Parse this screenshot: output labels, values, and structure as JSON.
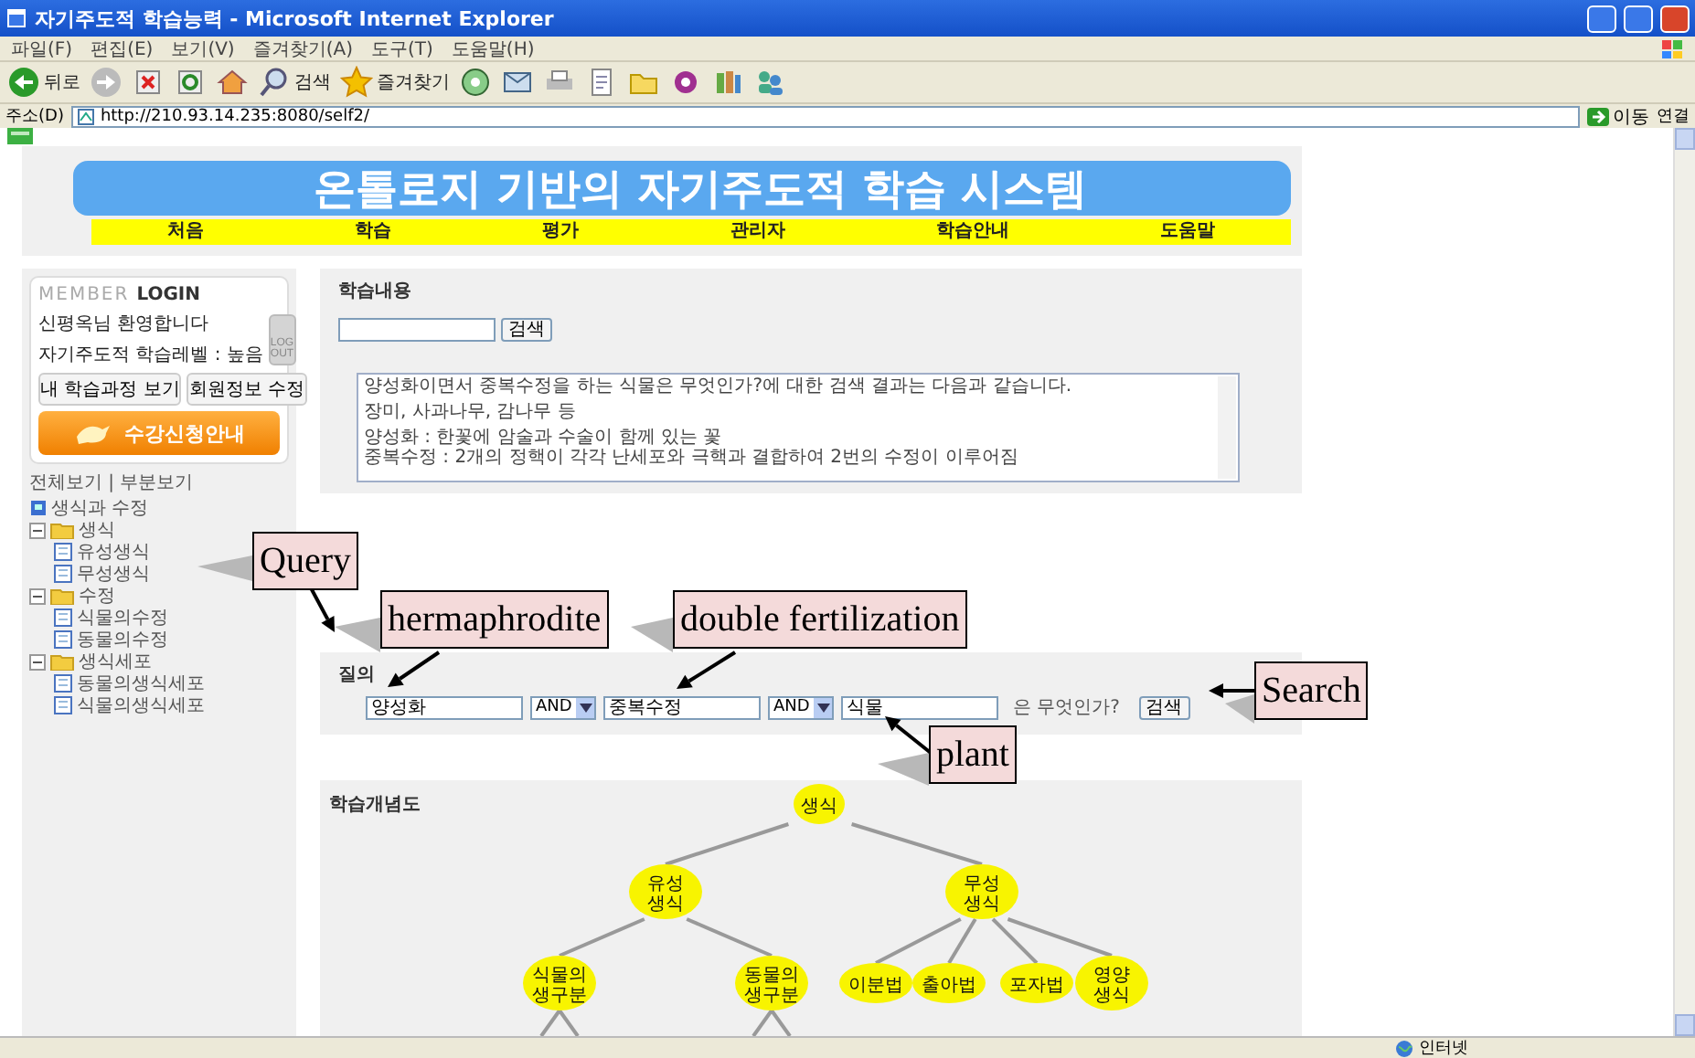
{
  "window": {
    "title": "자기주도적 학습능력 - Microsoft Internet Explorer"
  },
  "menu": [
    "파일(F)",
    "편집(E)",
    "보기(V)",
    "즐겨찾기(A)",
    "도구(T)",
    "도움말(H)"
  ],
  "toolbar": [
    {
      "kind": "back",
      "label": "뒤로"
    },
    {
      "kind": "forward"
    },
    {
      "kind": "stop"
    },
    {
      "kind": "refresh"
    },
    {
      "kind": "home"
    },
    {
      "kind": "search",
      "label": "검색"
    },
    {
      "kind": "favorites",
      "label": "즐겨찾기"
    },
    {
      "kind": "media"
    },
    {
      "kind": "mail"
    },
    {
      "kind": "print"
    },
    {
      "kind": "edit"
    },
    {
      "kind": "folder"
    },
    {
      "kind": "messenger"
    },
    {
      "kind": "research"
    },
    {
      "kind": "users"
    }
  ],
  "address": {
    "label": "주소(D)",
    "url": "http://210.93.14.235:8080/self2/",
    "go": "이동",
    "links": "연결"
  },
  "page": {
    "banner": "온톨로지 기반의 자기주도적 학습 시스템",
    "nav": [
      "처음",
      "학습",
      "평가",
      "관리자",
      "학습안내",
      "도움말"
    ],
    "login": {
      "title_1": "MEMBER",
      "title_2": "LOGIN",
      "welcome": "신평옥님 환영합니다",
      "level": "자기주도적 학습레벨 : 높음",
      "logout": "LOG OUT",
      "buttons": [
        "내 학습과정 보기",
        "회원정보 수정"
      ],
      "banner": "수강신청안내"
    },
    "tree_views": "전체보기 | 부분보기",
    "tree": {
      "label": "생식과 수정",
      "children": [
        {
          "label": "생식",
          "expanded": true,
          "children": [
            {
              "label": "유성생식"
            },
            {
              "label": "무성생식"
            }
          ]
        },
        {
          "label": "수정",
          "expanded": true,
          "children": [
            {
              "label": "식물의수정"
            },
            {
              "label": "동물의수정"
            }
          ]
        },
        {
          "label": "생식세포",
          "expanded": true,
          "children": [
            {
              "label": "동물의생식세포"
            },
            {
              "label": "식물의생식세포"
            }
          ]
        }
      ]
    },
    "content": {
      "heading": "학습내용",
      "search_button": "검색",
      "result": [
        "양성화이면서 중복수정을 하는 식물은 무엇인가?에 대한 검색 결과는 다음과 같습니다.",
        "장미, 사과나무, 감나무 등",
        "양성화 : 한꽃에 암술과 수술이 함께 있는 꽃\n중복수정 : 2개의 정핵이 각각 난세포와 극핵과 결합하여 2번의 수정이 이루어짐"
      ]
    },
    "query": {
      "heading": "질의",
      "terms": [
        "양성화",
        "중복수정",
        "식물"
      ],
      "operators": [
        "AND",
        "AND"
      ],
      "suffix": "은 무엇인가?",
      "button": "검색"
    },
    "concept_map": {
      "title": "학습개념도",
      "root": {
        "label": "생식",
        "children": [
          {
            "label": "유성 생식",
            "children": [
              {
                "label": "식물의 생구분"
              },
              {
                "label": "동물의 생구분"
              }
            ]
          },
          {
            "label": "무성 생식",
            "children": [
              {
                "label": "이분법"
              },
              {
                "label": "출아법"
              },
              {
                "label": "포자법"
              },
              {
                "label": "영양 생식"
              }
            ]
          }
        ]
      }
    }
  },
  "callouts": [
    {
      "text": "Query"
    },
    {
      "text": "hermaphrodite"
    },
    {
      "text": "double fertilization"
    },
    {
      "text": "Search"
    },
    {
      "text": "plant"
    }
  ],
  "status_bar": {
    "zone": "인터넷"
  }
}
